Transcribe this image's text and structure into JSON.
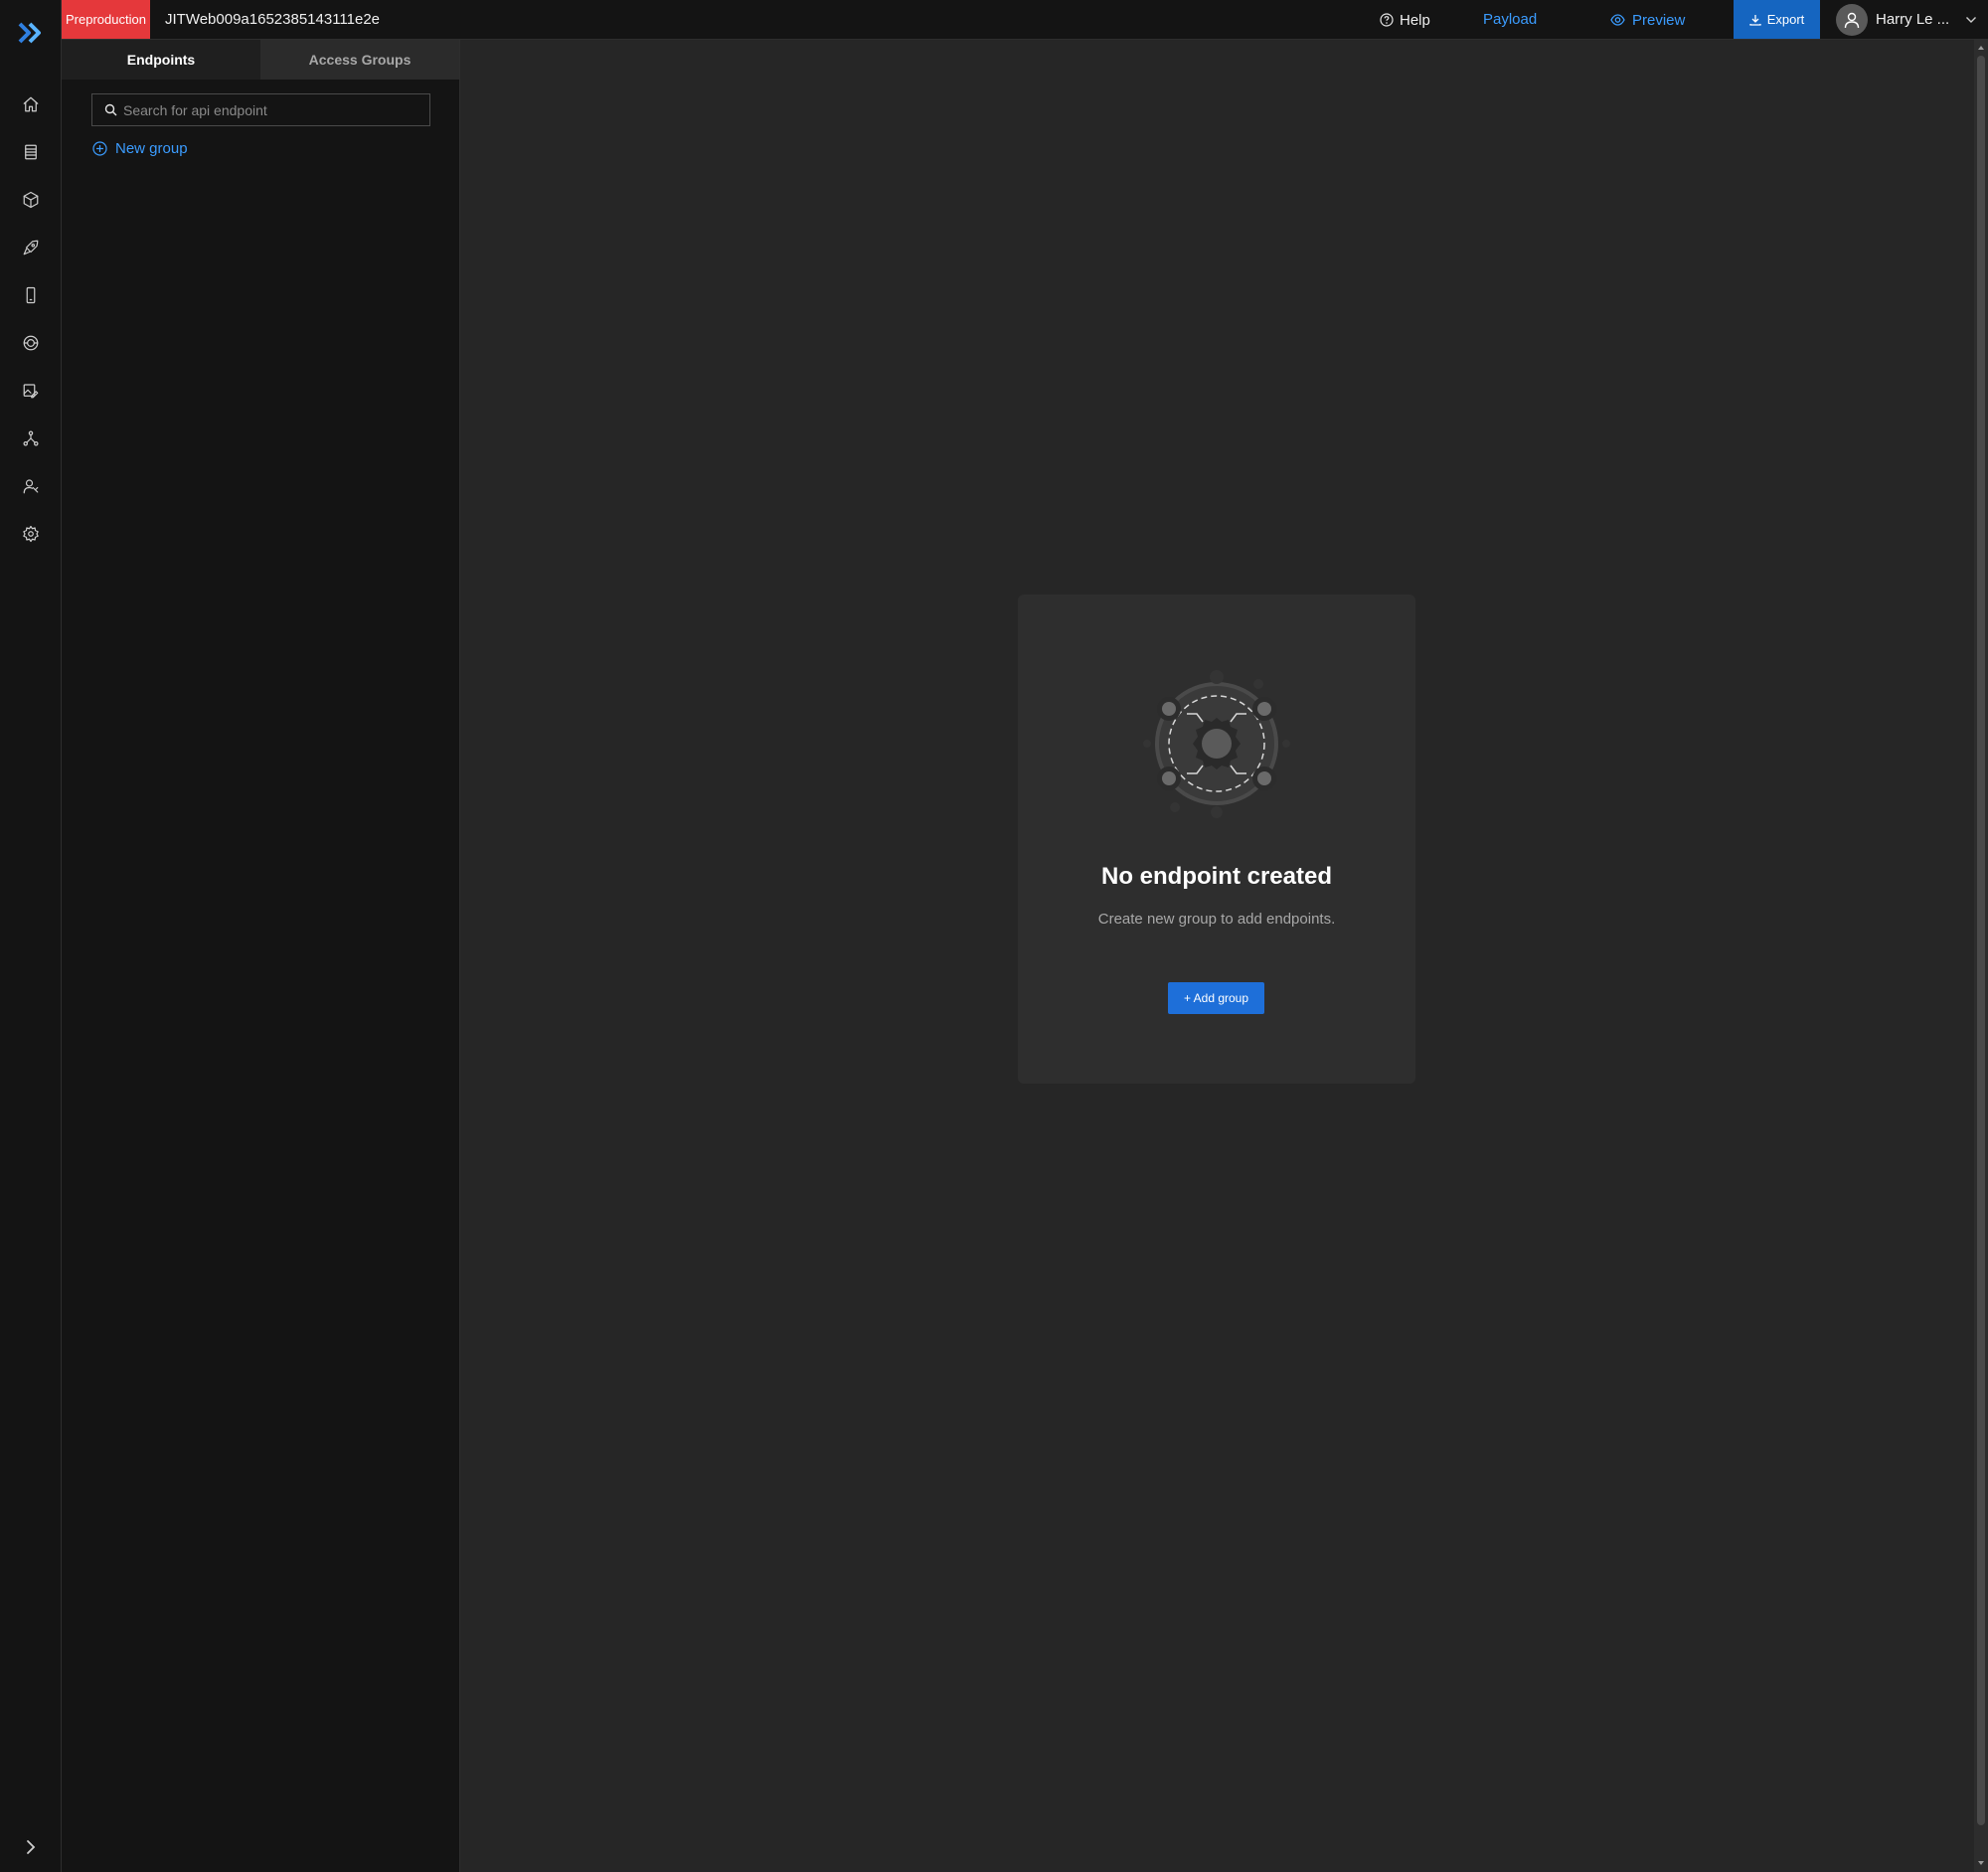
{
  "topbar": {
    "environment": "Preproduction",
    "project_name": "JITWeb009a1652385143111e2e",
    "help_label": "Help",
    "payload_label": "Payload",
    "preview_label": "Preview",
    "export_label": "Export",
    "user_name": "Harry Le ..."
  },
  "rail": {
    "icons": [
      "logo-icon",
      "home-icon",
      "database-icon",
      "cube-icon",
      "rocket-icon",
      "mobile-icon",
      "globe-icon",
      "image-edit-icon",
      "network-icon",
      "users-icon",
      "gear-icon",
      "chevron-right-icon"
    ]
  },
  "side_panel": {
    "tabs": [
      {
        "label": "Endpoints",
        "active": true
      },
      {
        "label": "Access Groups",
        "active": false
      }
    ],
    "search_placeholder": "Search for api endpoint",
    "new_group_label": "New group"
  },
  "empty_state": {
    "title": "No endpoint created",
    "description": "Create new group to add endpoints.",
    "button_label": "+ Add group"
  },
  "colors": {
    "accent": "#3b9cff",
    "env_badge": "#e5383b",
    "export_button": "#1565c0",
    "primary_button": "#1e6fd9",
    "background": "#262626",
    "panel": "#141414"
  }
}
